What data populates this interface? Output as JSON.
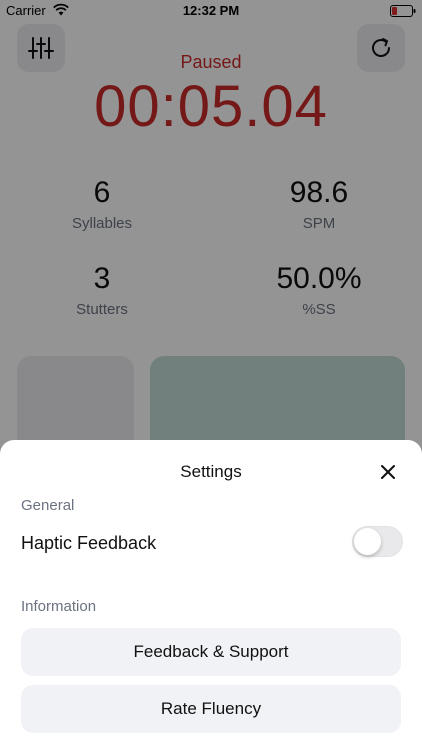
{
  "status_bar": {
    "carrier": "Carrier",
    "time": "12:32 PM"
  },
  "timer": {
    "status": "Paused",
    "value": "00:05.04"
  },
  "stats": {
    "syllables": {
      "value": "6",
      "label": "Syllables"
    },
    "spm": {
      "value": "98.6",
      "label": "SPM"
    },
    "stutters": {
      "value": "3",
      "label": "Stutters"
    },
    "percent_ss": {
      "value": "50.0%",
      "label": "%SS"
    }
  },
  "settings_sheet": {
    "title": "Settings",
    "general_label": "General",
    "haptic_label": "Haptic Feedback",
    "haptic_enabled": false,
    "information_label": "Information",
    "feedback_button": "Feedback & Support",
    "rate_button": "Rate Fluency"
  },
  "colors": {
    "timer_red": "#c92a2a",
    "panel_teal": "#c3ddd6",
    "muted_text": "#6b7280",
    "button_bg": "#f1f2f5"
  },
  "icons": {
    "settings": "sliders-icon",
    "reset": "refresh-icon",
    "close": "close-icon",
    "wifi": "wifi-icon",
    "battery": "battery-low-icon"
  }
}
